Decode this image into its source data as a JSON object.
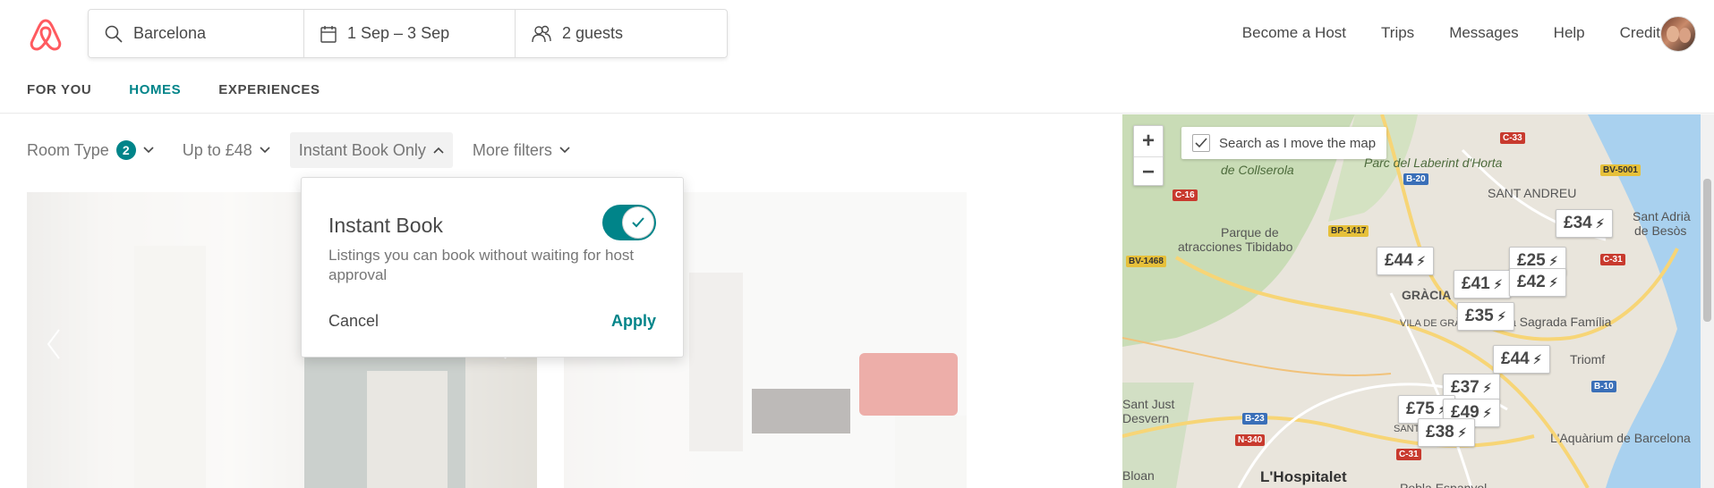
{
  "header": {
    "search": {
      "location": "Barcelona",
      "dates": "1 Sep – 3 Sep",
      "guests": "2 guests"
    },
    "nav": [
      "Become a Host",
      "Trips",
      "Messages",
      "Help",
      "Credit"
    ]
  },
  "tabs": [
    "FOR YOU",
    "HOMES",
    "EXPERIENCES"
  ],
  "filters": {
    "room_type": "Room Type",
    "room_type_count": "2",
    "price": "Up to £48",
    "instant_book": "Instant Book Only",
    "more": "More filters"
  },
  "popover": {
    "title": "Instant Book",
    "description": "Listings you can book without waiting for host approval",
    "cancel": "Cancel",
    "apply": "Apply",
    "toggle_on": true
  },
  "map": {
    "search_as_move": "Search as I move the map",
    "labels": [
      "Parque de",
      "atracciones Tibidabo",
      "de Collserola",
      "Parc del Laberint d'Horta",
      "SANT ANDREU",
      "Sant Adrià",
      "de Besòs",
      "GRÀCIA",
      "VILA DE GRÀ",
      "a Sagrada Família",
      "Triomf",
      "Sant Just",
      "Desvern",
      "SANTS",
      "L'Aquàrium de Barcelona",
      "L'Hospitalet",
      "Bloan",
      "Pobla Espanyol"
    ],
    "roads": [
      "C-33",
      "B-20",
      "BV-5001",
      "BP-1417",
      "C-16",
      "BV-1468",
      "C-31",
      "B-10",
      "B-23",
      "N-340",
      "C-31"
    ],
    "prices": [
      "£44",
      "£34",
      "£25",
      "£41",
      "£42",
      "£35",
      "£44",
      "£37",
      "£75",
      "£49",
      "£38"
    ]
  },
  "colors": {
    "accent": "#008489",
    "brand": "#FF5A5F"
  }
}
